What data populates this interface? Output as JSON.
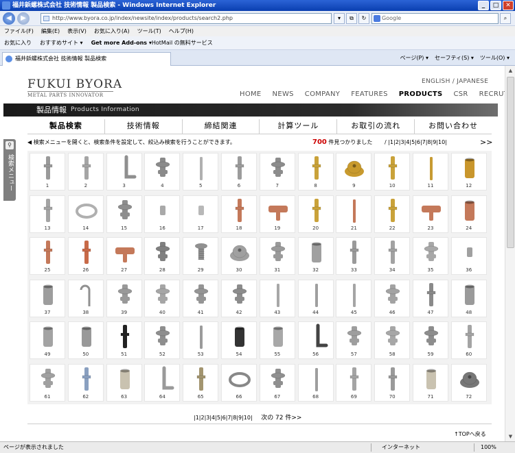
{
  "browser": {
    "title": "福井鋲螺株式会社 技術情報 製品検索 - Windows Internet Explorer",
    "url": "http://www.byora.co.jp/index/newsite/index/products/search2.php",
    "search_placeholder": "Google",
    "menu": [
      "ファイル(F)",
      "編集(E)",
      "表示(V)",
      "お気に入り(A)",
      "ツール(T)",
      "ヘルプ(H)"
    ],
    "favorites": [
      "お気に入り",
      "おすすめサイト ▾",
      "Get more Add-ons ▾",
      "HotMail の無料サービス"
    ],
    "tab_title": "福井鋲螺株式会社 技術情報 製品検索",
    "tools": [
      "ページ(P) ▾",
      "セーフティ(S) ▾",
      "ツール(O) ▾"
    ],
    "status_left": "ページが表示されました",
    "status_zone": "インターネット",
    "zoom": "100%"
  },
  "site": {
    "logo": "FUKUI BYORA",
    "logo_sub": "METAL PARTS INNOVATOR",
    "lang": "ENGLISH  /  JAPANESE",
    "nav": [
      "HOME",
      "NEWS",
      "COMPANY",
      "FEATURES",
      "PRODUCTS",
      "CSR",
      "RECRUTING"
    ],
    "section_jp": "製品情報",
    "section_en": "Products Information",
    "subtabs": [
      "製品検索",
      "技術情報",
      "締結関連",
      "計算ツール",
      "お取引の流れ",
      "お問い合わせ"
    ],
    "side_tab": "検索メニュー",
    "info_msg": "◀ 検索メニューを開くと、検索条件を設定して、絞込み検索を行うことができます。",
    "count": "700",
    "count_suffix": " 件見つかりました",
    "pages_line": "/ |1|2|3|4|5|6|7|8|9|10|",
    "next_arrow": ">>",
    "pager_bottom": "|1|2|3|4|5|6|7|8|9|10|",
    "next_label": "次の 72 件>>",
    "totop": "↑TOPへ戻る"
  },
  "products": [
    {
      "n": "1",
      "shape": "pin",
      "color": "#9a9a9a"
    },
    {
      "n": "2",
      "shape": "pin",
      "color": "#a5a5a5"
    },
    {
      "n": "3",
      "shape": "lbar",
      "color": "#8f8f8f"
    },
    {
      "n": "4",
      "shape": "post",
      "color": "#8a8a8a"
    },
    {
      "n": "5",
      "shape": "thin",
      "color": "#b0b0b0"
    },
    {
      "n": "6",
      "shape": "pin",
      "color": "#9c9c9c"
    },
    {
      "n": "7",
      "shape": "post",
      "color": "#8c8c8c"
    },
    {
      "n": "8",
      "shape": "pin",
      "color": "#c9a23a"
    },
    {
      "n": "9",
      "shape": "dome",
      "color": "#c89a2e"
    },
    {
      "n": "10",
      "shape": "pin",
      "color": "#c9a23a"
    },
    {
      "n": "11",
      "shape": "thin",
      "color": "#c79b33"
    },
    {
      "n": "12",
      "shape": "cyl",
      "color": "#c9962c"
    },
    {
      "n": "13",
      "shape": "pin",
      "color": "#a4a4a4"
    },
    {
      "n": "14",
      "shape": "ring",
      "color": "#b0b0b0"
    },
    {
      "n": "15",
      "shape": "post",
      "color": "#8e8e8e"
    },
    {
      "n": "16",
      "shape": "small",
      "color": "#a9a9a9"
    },
    {
      "n": "17",
      "shape": "small",
      "color": "#b8b8b8"
    },
    {
      "n": "18",
      "shape": "pin",
      "color": "#c4795a"
    },
    {
      "n": "19",
      "shape": "tab",
      "color": "#c4795a"
    },
    {
      "n": "20",
      "shape": "pin",
      "color": "#c9a23a"
    },
    {
      "n": "21",
      "shape": "thin",
      "color": "#c4795a"
    },
    {
      "n": "22",
      "shape": "pin",
      "color": "#c9a23a"
    },
    {
      "n": "23",
      "shape": "tab",
      "color": "#c4795a"
    },
    {
      "n": "24",
      "shape": "cyl",
      "color": "#c4795a"
    },
    {
      "n": "25",
      "shape": "pin",
      "color": "#c4795a"
    },
    {
      "n": "26",
      "shape": "pin",
      "color": "#c86a48"
    },
    {
      "n": "27",
      "shape": "tab",
      "color": "#c4795a"
    },
    {
      "n": "28",
      "shape": "post",
      "color": "#808080"
    },
    {
      "n": "29",
      "shape": "screw",
      "color": "#909090"
    },
    {
      "n": "30",
      "shape": "dome",
      "color": "#a0a0a0"
    },
    {
      "n": "31",
      "shape": "post",
      "color": "#9a9a9a"
    },
    {
      "n": "32",
      "shape": "cyl",
      "color": "#a0a0a0"
    },
    {
      "n": "33",
      "shape": "pin",
      "color": "#9a9a9a"
    },
    {
      "n": "34",
      "shape": "pin",
      "color": "#a2a2a2"
    },
    {
      "n": "35",
      "shape": "post",
      "color": "#a8a8a8"
    },
    {
      "n": "36",
      "shape": "small",
      "color": "#a0a0a0"
    },
    {
      "n": "37",
      "shape": "cyl",
      "color": "#9d9d9d"
    },
    {
      "n": "38",
      "shape": "hook",
      "color": "#909090"
    },
    {
      "n": "39",
      "shape": "post",
      "color": "#999999"
    },
    {
      "n": "40",
      "shape": "post",
      "color": "#a6a6a6"
    },
    {
      "n": "41",
      "shape": "post",
      "color": "#959595"
    },
    {
      "n": "42",
      "shape": "post",
      "color": "#8c8c8c"
    },
    {
      "n": "43",
      "shape": "thin",
      "color": "#a7a7a7"
    },
    {
      "n": "44",
      "shape": "thin",
      "color": "#9f9f9f"
    },
    {
      "n": "45",
      "shape": "thin",
      "color": "#a5a5a5"
    },
    {
      "n": "46",
      "shape": "post",
      "color": "#a3a3a3"
    },
    {
      "n": "47",
      "shape": "pin",
      "color": "#8a8a8a"
    },
    {
      "n": "48",
      "shape": "cyl",
      "color": "#9a9a9a"
    },
    {
      "n": "49",
      "shape": "cyl",
      "color": "#a3a3a3"
    },
    {
      "n": "50",
      "shape": "cyl",
      "color": "#999999"
    },
    {
      "n": "51",
      "shape": "pin",
      "color": "#222222"
    },
    {
      "n": "52",
      "shape": "post",
      "color": "#8e8e8e"
    },
    {
      "n": "53",
      "shape": "thin",
      "color": "#9b9b9b"
    },
    {
      "n": "54",
      "shape": "cyl",
      "color": "#333333"
    },
    {
      "n": "55",
      "shape": "cyl",
      "color": "#a8a8a8"
    },
    {
      "n": "56",
      "shape": "lbar",
      "color": "#444444"
    },
    {
      "n": "57",
      "shape": "post",
      "color": "#9e9e9e"
    },
    {
      "n": "58",
      "shape": "post",
      "color": "#a7a7a7"
    },
    {
      "n": "59",
      "shape": "post",
      "color": "#8d8d8d"
    },
    {
      "n": "60",
      "shape": "pin",
      "color": "#a4a4a4"
    },
    {
      "n": "61",
      "shape": "post",
      "color": "#a0a0a0"
    },
    {
      "n": "62",
      "shape": "pin",
      "color": "#8aa0c0"
    },
    {
      "n": "63",
      "shape": "cyl",
      "color": "#c9c2b0"
    },
    {
      "n": "64",
      "shape": "lbar",
      "color": "#9a9a9a"
    },
    {
      "n": "65",
      "shape": "pin",
      "color": "#a39570"
    },
    {
      "n": "66",
      "shape": "ring",
      "color": "#888888"
    },
    {
      "n": "67",
      "shape": "post",
      "color": "#8f8f8f"
    },
    {
      "n": "68",
      "shape": "thin",
      "color": "#9e9e9e"
    },
    {
      "n": "69",
      "shape": "pin",
      "color": "#a4a4a4"
    },
    {
      "n": "70",
      "shape": "pin",
      "color": "#9a9a9a"
    },
    {
      "n": "71",
      "shape": "cyl",
      "color": "#c9c2b0"
    },
    {
      "n": "72",
      "shape": "dome",
      "color": "#777777"
    }
  ]
}
